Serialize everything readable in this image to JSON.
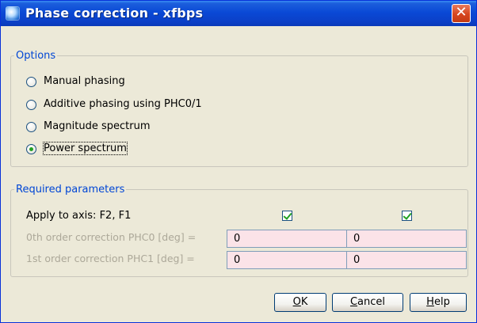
{
  "window": {
    "title": "Phase correction - xfbps",
    "close_glyph": "✕"
  },
  "options": {
    "legend": "Options",
    "items": [
      {
        "label": "Manual phasing",
        "checked": false
      },
      {
        "label": "Additive phasing using PHC0/1",
        "checked": false
      },
      {
        "label": "Magnitude spectrum",
        "checked": false
      },
      {
        "label": "Power spectrum",
        "checked": true
      }
    ]
  },
  "parameters": {
    "legend": "Required parameters",
    "apply_axis_label": "Apply to axis: F2, F1",
    "apply_f2_checked": true,
    "apply_f1_checked": true,
    "phc0_label": "0th order correction PHC0 [deg] =",
    "phc0_f2": "0",
    "phc0_f1": "0",
    "phc1_label": "1st order correction PHC1 [deg] =",
    "phc1_f2": "0",
    "phc1_f1": "0"
  },
  "buttons": {
    "ok": {
      "mnemonic": "O",
      "rest": "K"
    },
    "cancel": {
      "mnemonic": "C",
      "rest": "ancel"
    },
    "help": {
      "mnemonic": "H",
      "rest": "elp"
    }
  },
  "colors": {
    "titlebar": "#0a49d6",
    "legend_text": "#0046d5",
    "field_bg": "#fbe3e8",
    "check_green": "#21a121",
    "close_red": "#d6461e"
  }
}
